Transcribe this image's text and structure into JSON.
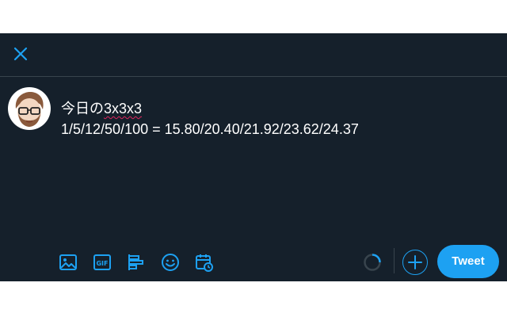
{
  "compose": {
    "line1_prefix": "今日の",
    "line1_word": "3x3x3",
    "line2": "1/5/12/50/100 = 15.80/20.40/21.92/23.62/24.37"
  },
  "toolbar": {
    "icons": [
      "image-icon",
      "gif-icon",
      "poll-icon",
      "emoji-icon",
      "schedule-icon"
    ]
  },
  "tweet_button": {
    "label": "Tweet"
  },
  "colors": {
    "background": "#15202b",
    "accent": "#1da1f2",
    "border": "#38444d",
    "spellcheck": "#e0245e"
  }
}
